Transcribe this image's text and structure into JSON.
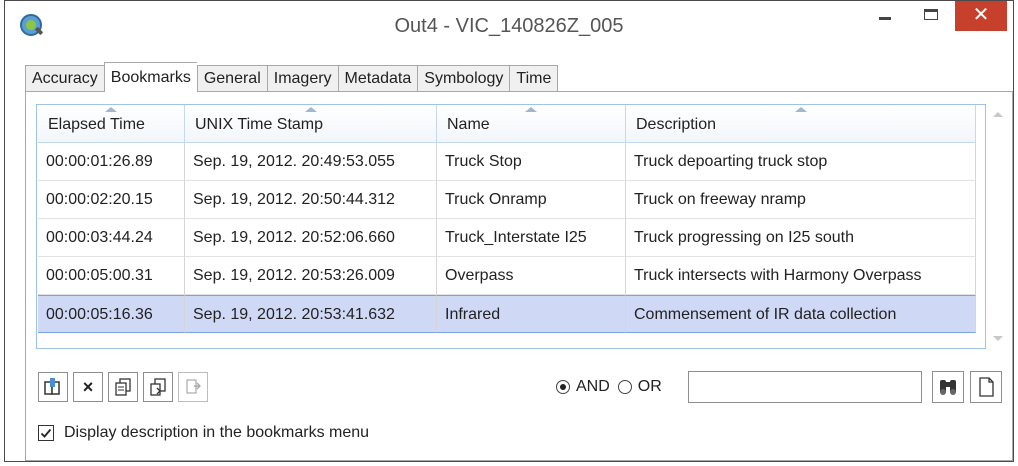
{
  "window": {
    "title": "Out4 - VIC_140826Z_005",
    "close_glyph": "✕"
  },
  "tabs": [
    {
      "label": "Accuracy"
    },
    {
      "label": "Bookmarks",
      "active": true
    },
    {
      "label": "General"
    },
    {
      "label": "Imagery"
    },
    {
      "label": "Metadata"
    },
    {
      "label": "Symbology"
    },
    {
      "label": "Time"
    }
  ],
  "table": {
    "columns": [
      "Elapsed Time",
      "UNIX Time Stamp",
      "Name",
      "Description"
    ],
    "rows": [
      [
        "00:00:01:26.89",
        "Sep. 19, 2012. 20:49:53.055",
        "Truck Stop",
        "Truck depoarting truck stop"
      ],
      [
        "00:00:02:20.15",
        "Sep. 19, 2012. 20:50:44.312",
        "Truck Onramp",
        "Truck on freeway nramp"
      ],
      [
        "00:00:03:44.24",
        "Sep. 19, 2012. 20:52:06.660",
        "Truck_Interstate I25",
        "Truck progressing on I25 south"
      ],
      [
        "00:00:05:00.31",
        "Sep. 19, 2012. 20:53:26.009",
        "Overpass",
        "Truck intersects with Harmony Overpass"
      ],
      [
        "00:00:05:16.36",
        "Sep. 19, 2012. 20:53:41.632",
        "Infrared",
        "Commensement of IR data collection"
      ]
    ],
    "selected_row": 4
  },
  "toolbar": {
    "delete_glyph": "×",
    "icons": [
      "add-bookmark-icon",
      "delete-icon",
      "copy-icon",
      "paste-icon",
      "import-icon"
    ]
  },
  "search": {
    "and_label": "AND",
    "or_label": "OR",
    "selected_operator": "AND",
    "value": ""
  },
  "options": {
    "display_description_label": "Display description in the bookmarks menu",
    "display_description_checked": true
  },
  "colors": {
    "close_button": "#c7402c",
    "selected_row": "#cfd9f6",
    "grid_border": "#9fc3e8"
  }
}
